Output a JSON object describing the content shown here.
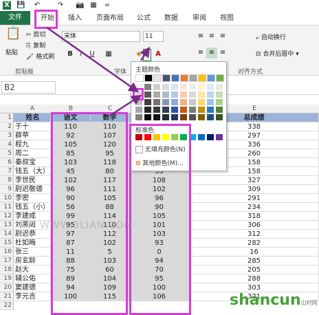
{
  "quickaccess": {
    "excel": "X",
    "save": "💾",
    "undo": "↶",
    "redo": "↷",
    "camera": "📷",
    "table": "▦",
    "more": "="
  },
  "tabs": [
    "文件",
    "开始",
    "插入",
    "页面布局",
    "公式",
    "数据",
    "审阅",
    "视图"
  ],
  "ribbon": {
    "cut": "剪切",
    "copy": "复制",
    "format_painter": "格式刷",
    "paste": "粘贴",
    "clipboard_label": "剪贴板",
    "font_name": "宋体",
    "font_size": "11",
    "font_label": "字体",
    "bold": "B",
    "italic": "I",
    "underline": "U",
    "wrap_text": "自动换行",
    "merge_center": "合并后居中",
    "align_label": "对齐方式"
  },
  "formula_bar": {
    "name_box": "B2"
  },
  "columns": [
    "A",
    "B",
    "C",
    "D",
    "E"
  ],
  "table": {
    "headers": [
      "姓名",
      "语文",
      "数学",
      "",
      "总成绩"
    ],
    "rows": [
      [
        "于十",
        "110",
        "110",
        "",
        "338"
      ],
      [
        "薛苹",
        "92",
        "107",
        "",
        "297"
      ],
      [
        "程九",
        "105",
        "120",
        "",
        "336"
      ],
      [
        "周二",
        "85",
        "95",
        "",
        "260"
      ],
      [
        "秦叔宝",
        "103",
        "118",
        "",
        "158"
      ],
      [
        "钱五（大）",
        "45",
        "80",
        "33",
        "158"
      ],
      [
        "李世民",
        "102",
        "117",
        "108",
        "327"
      ],
      [
        "尉迟敬德",
        "96",
        "111",
        "102",
        "309"
      ],
      [
        "李密",
        "90",
        "105",
        "96",
        "291"
      ],
      [
        "钱五（小）",
        "56",
        "88",
        "90",
        "234"
      ],
      [
        "李建成",
        "99",
        "114",
        "105",
        "318"
      ],
      [
        "刘黑闼",
        "95",
        "110",
        "101",
        "306"
      ],
      [
        "尉迟恭",
        "97",
        "112",
        "103",
        "312"
      ],
      [
        "杜如晦",
        "87",
        "102",
        "93",
        "282"
      ],
      [
        "张三",
        "11",
        "5",
        "0",
        "16"
      ],
      [
        "房玄龄",
        "88",
        "103",
        "94",
        "285"
      ],
      [
        "赵大",
        "75",
        "60",
        "70",
        "205"
      ],
      [
        "辅公佑",
        "89",
        "104",
        "95",
        "288"
      ],
      [
        "窦建德",
        "94",
        "109",
        "100",
        "303"
      ],
      [
        "李元吉",
        "100",
        "115",
        "106",
        "321"
      ]
    ],
    "row_numbers": [
      "1",
      "2",
      "3",
      "4",
      "5",
      "6",
      "7",
      "8",
      "9",
      "10",
      "11",
      "12",
      "13",
      "14",
      "15",
      "16",
      "17",
      "18",
      "19",
      "20",
      "21",
      "22"
    ]
  },
  "palette": {
    "theme_label": "主题颜色",
    "standard_label": "标准色",
    "no_fill": "无填充颜色(N)",
    "more_colors": "其他颜色(M)...",
    "theme_top": [
      "#ffffff",
      "#000000",
      "#e7e6e6",
      "#44546a",
      "#4472c4",
      "#ed7d31",
      "#a5a5a5",
      "#ffc000",
      "#5b9bd5",
      "#70ad47"
    ],
    "theme_cols": [
      [
        "#f2f2f2",
        "#d9d9d9",
        "#bfbfbf",
        "#a6a6a6",
        "#808080"
      ],
      [
        "#808080",
        "#595959",
        "#404040",
        "#262626",
        "#0d0d0d"
      ],
      [
        "#d0cece",
        "#aeaaaa",
        "#757171",
        "#3b3838",
        "#171616"
      ],
      [
        "#d6dce5",
        "#adb9ca",
        "#8497b0",
        "#333f50",
        "#222a35"
      ],
      [
        "#dae3f3",
        "#b4c7e7",
        "#8faadc",
        "#2f5597",
        "#203864"
      ],
      [
        "#fbe5d6",
        "#f8cbad",
        "#f4b183",
        "#c55a11",
        "#843c0c"
      ],
      [
        "#ededed",
        "#dbdbdb",
        "#c9c9c9",
        "#7b7b7b",
        "#525252"
      ],
      [
        "#fff2cc",
        "#ffe699",
        "#ffd966",
        "#bf9000",
        "#7f6000"
      ],
      [
        "#deebf7",
        "#bdd7ee",
        "#9dc3e6",
        "#2e75b6",
        "#1f4e79"
      ],
      [
        "#e2f0d9",
        "#c5e0b4",
        "#a9d18e",
        "#548235",
        "#385723"
      ]
    ],
    "standard": [
      "#c00000",
      "#ff0000",
      "#ffc000",
      "#ffff00",
      "#92d050",
      "#00b050",
      "#00b0f0",
      "#0070c0",
      "#002060",
      "#7030a0"
    ]
  },
  "watermark": "WWW.3LIAN.COM",
  "logo": {
    "main": "shancun",
    "sub": "山村网"
  }
}
